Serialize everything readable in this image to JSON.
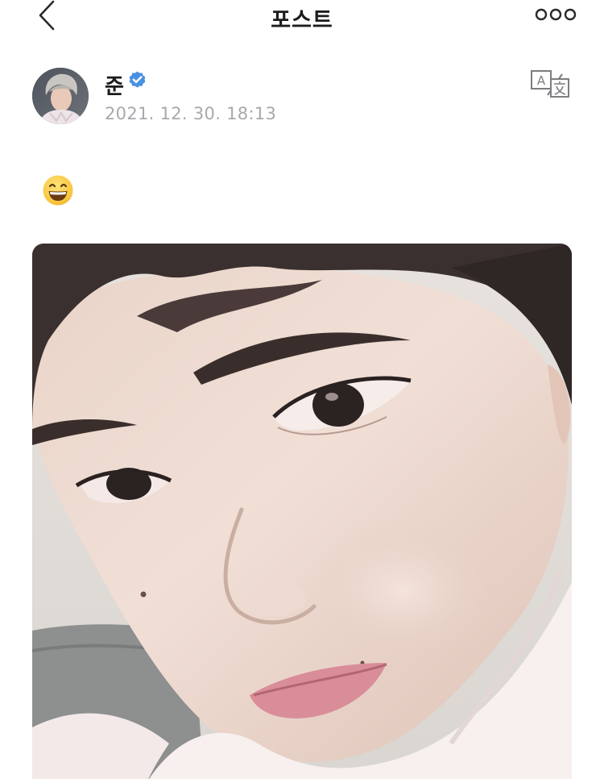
{
  "header": {
    "title": "포스트",
    "back_icon": "chevron-left-icon",
    "more_icon": "more-dots-icon"
  },
  "post": {
    "author": {
      "name": "준",
      "verified": true,
      "badge_color": "#4a90e2"
    },
    "timestamp": "2021. 12. 30. 18:13",
    "translate_icon": "translate-icon",
    "body_emoji": "grinning-face-with-smiling-eyes",
    "image": "selfie-photo"
  },
  "colors": {
    "background": "#ffffff",
    "title": "#1c1c1c",
    "timestamp": "#a8a8ad",
    "verified_badge": "#4a90e2"
  }
}
